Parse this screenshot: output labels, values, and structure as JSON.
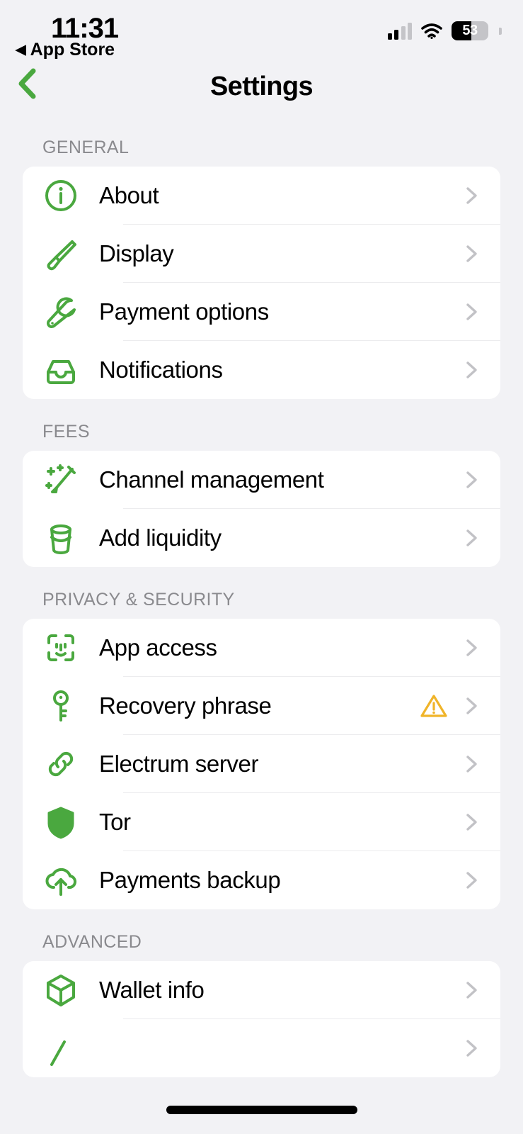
{
  "status_bar": {
    "time": "11:31",
    "return_label": "App Store",
    "return_arrow": "◀",
    "battery_percent": "53",
    "battery_level": 53,
    "signal_bars_active": 2,
    "signal_bars_total": 4
  },
  "nav": {
    "title": "Settings",
    "back_icon": "chevron-left-icon"
  },
  "colors": {
    "accent_green": "#4aa83f",
    "warning_amber": "#f0b429",
    "background": "#f2f2f5",
    "card": "#ffffff",
    "section_header": "#8a8a8e",
    "chevron": "#c2c2c6"
  },
  "sections": [
    {
      "header": "GENERAL",
      "rows": [
        {
          "label": "About",
          "icon": "info-circle-icon",
          "warning": false
        },
        {
          "label": "Display",
          "icon": "paintbrush-icon",
          "warning": false
        },
        {
          "label": "Payment options",
          "icon": "wrench-icon",
          "warning": false
        },
        {
          "label": "Notifications",
          "icon": "inbox-tray-icon",
          "warning": false
        }
      ]
    },
    {
      "header": "FEES",
      "rows": [
        {
          "label": "Channel management",
          "icon": "magic-wand-icon",
          "warning": false
        },
        {
          "label": "Add liquidity",
          "icon": "bucket-icon",
          "warning": false
        }
      ]
    },
    {
      "header": "PRIVACY & SECURITY",
      "rows": [
        {
          "label": "App access",
          "icon": "face-id-icon",
          "warning": false
        },
        {
          "label": "Recovery phrase",
          "icon": "key-icon",
          "warning": true
        },
        {
          "label": "Electrum server",
          "icon": "chain-link-icon",
          "warning": false
        },
        {
          "label": "Tor",
          "icon": "shield-icon",
          "warning": false
        },
        {
          "label": "Payments backup",
          "icon": "cloud-upload-icon",
          "warning": false
        }
      ]
    },
    {
      "header": "ADVANCED",
      "rows": [
        {
          "label": "Wallet info",
          "icon": "cube-icon",
          "warning": false
        },
        {
          "label": "",
          "icon": "partial-icon",
          "warning": false
        }
      ]
    }
  ]
}
